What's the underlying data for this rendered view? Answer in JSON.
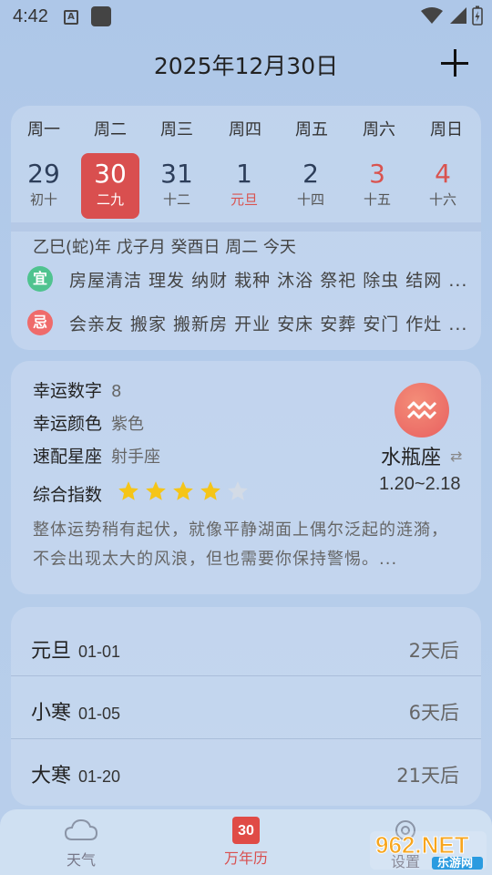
{
  "status_bar": {
    "time": "4:42"
  },
  "header": {
    "date": "2025年12月30日"
  },
  "calendar": {
    "weekdays": [
      "周一",
      "周二",
      "周三",
      "周四",
      "周五",
      "周六",
      "周日"
    ],
    "days": [
      {
        "num": "29",
        "lunar": "初十"
      },
      {
        "num": "30",
        "lunar": "二九"
      },
      {
        "num": "31",
        "lunar": "十二"
      },
      {
        "num": "1",
        "lunar": "元旦"
      },
      {
        "num": "2",
        "lunar": "十四"
      },
      {
        "num": "3",
        "lunar": "十五"
      },
      {
        "num": "4",
        "lunar": "十六"
      }
    ],
    "ganzhi": "乙巳(蛇)年 戊子月 癸酉日 周二 今天",
    "yi_badge": "宜",
    "yi_text": "房屋清洁 理发 纳财 栽种 沐浴 祭祀 除虫 结网 ...",
    "ji_badge": "忌",
    "ji_text": "会亲友 搬家 搬新房 开业 安床 安葬 安门 作灶 ..."
  },
  "luck": {
    "number_label": "幸运数字",
    "number_value": "8",
    "color_label": "幸运颜色",
    "color_value": "紫色",
    "match_label": "速配星座",
    "match_value": "射手座",
    "index_label": "综合指数",
    "rating": 4,
    "rating_max": 5,
    "zodiac_name": "水瓶座",
    "zodiac_range": "1.20~2.18",
    "description": "整体运势稍有起伏，就像平静湖面上偶尔泛起的涟漪，不会出现太大的风浪，但也需要你保持警惕。..."
  },
  "holidays": [
    {
      "name": "元旦",
      "date": "01-01",
      "countdown": "2天后"
    },
    {
      "name": "小寒",
      "date": "01-05",
      "countdown": "6天后"
    },
    {
      "name": "大寒",
      "date": "01-20",
      "countdown": "21天后"
    }
  ],
  "nav": {
    "weather": "天气",
    "calendar": "万年历",
    "calendar_icon_num": "30",
    "settings": "设置"
  },
  "watermark": {
    "brand": "962.NET",
    "sub": "乐游网"
  },
  "colors": {
    "accent": "#d94f4f",
    "yi": "#4fc38f",
    "ji": "#ef6b6b",
    "star": "#f5c518"
  }
}
